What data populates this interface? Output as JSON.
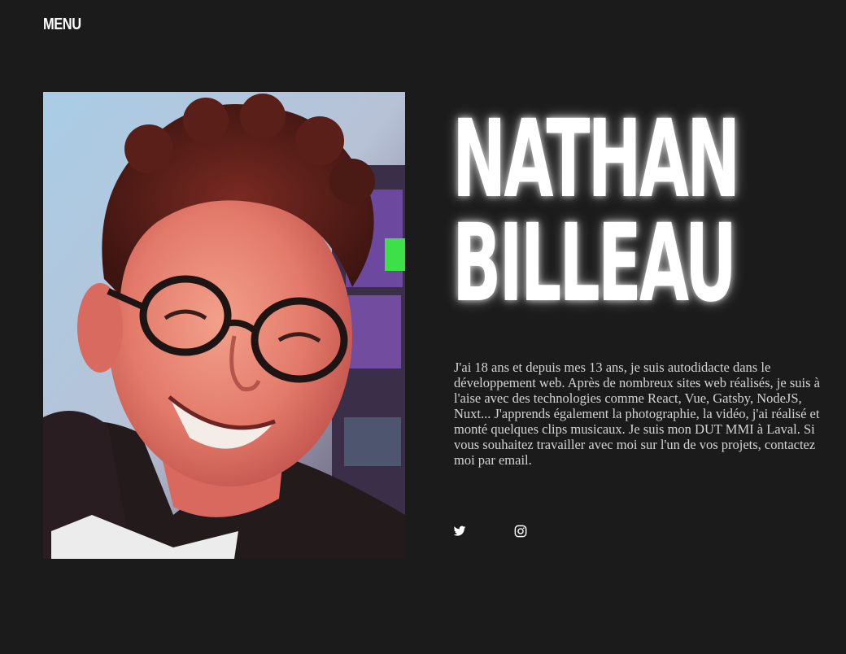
{
  "header": {
    "menu_label": "MENU"
  },
  "hero": {
    "first_name": "NATHAN",
    "last_name": "BILLEAU",
    "bio": "J'ai 18 ans et depuis mes 13 ans, je suis autodidacte dans le développement web. Après de nombreux sites web réalisés, je suis à l'aise avec des technologies comme React, Vue, Gatsby, NodeJS, Nuxt... J'apprends également la photographie, la vidéo, j'ai réalisé et monté quelques clips musicaux. Je suis mon DUT MMI à Laval. Si vous souhaitez travailler avec moi sur l'un de vos projets, contactez moi par email."
  },
  "social": [
    {
      "icon": "twitter-icon"
    },
    {
      "icon": "instagram-icon"
    }
  ],
  "colors": {
    "background": "#1b1b1b",
    "text": "#ffffff",
    "bio_text": "#d4d4d4"
  }
}
